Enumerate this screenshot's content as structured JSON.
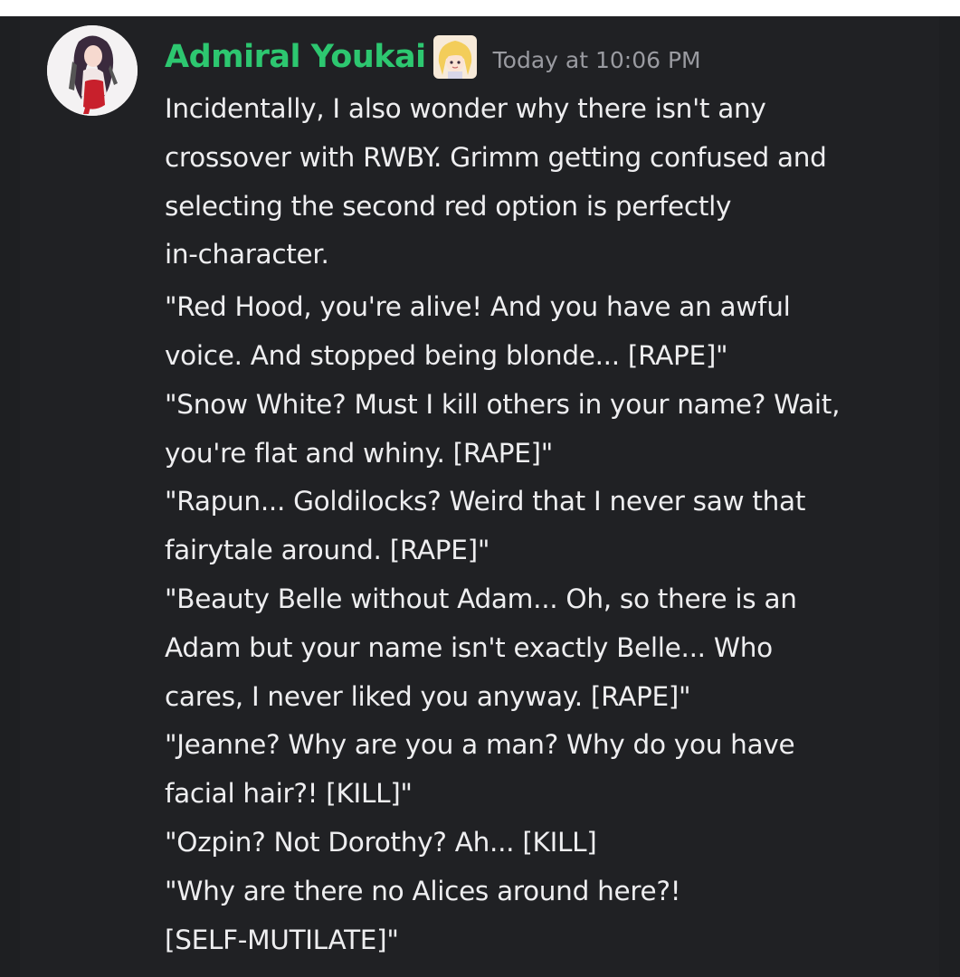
{
  "message": {
    "author": "Admiral Youkai",
    "timestamp": "Today at 10:06 PM",
    "avatar_icon": "anime-girl-avatar",
    "role_icon": "blonde-anime-emoji-icon",
    "colors": {
      "username": "#2dc770",
      "background": "#202124",
      "text": "#eeeef0",
      "timestamp": "#9a9ba1"
    },
    "paragraph1_lines": [
      "Incidentally, I also wonder why there isn't any",
      "crossover with RWBY. Grimm getting confused and",
      "selecting the second red option is perfectly",
      "in-character."
    ],
    "paragraph2_lines": [
      "\"Red Hood, you're alive! And you have an awful",
      "voice. And stopped being blonde... [RAPE]\"",
      "\"Snow White? Must I kill others in your name? Wait,",
      "you're flat and whiny. [RAPE]\"",
      "\"Rapun... Goldilocks? Weird that I never saw that",
      "fairytale around. [RAPE]\"",
      "\"Beauty Belle without Adam... Oh, so there is an",
      "Adam but your name isn't exactly Belle... Who",
      "cares, I never liked you anyway. [RAPE]\"",
      "\"Jeanne? Why are you a man? Why do you have",
      "facial hair?! [KILL]\"",
      "\"Ozpin? Not Dorothy? Ah... [KILL]",
      "\"Why are there no Alices around here?!",
      "[SELF-MUTILATE]\""
    ]
  }
}
